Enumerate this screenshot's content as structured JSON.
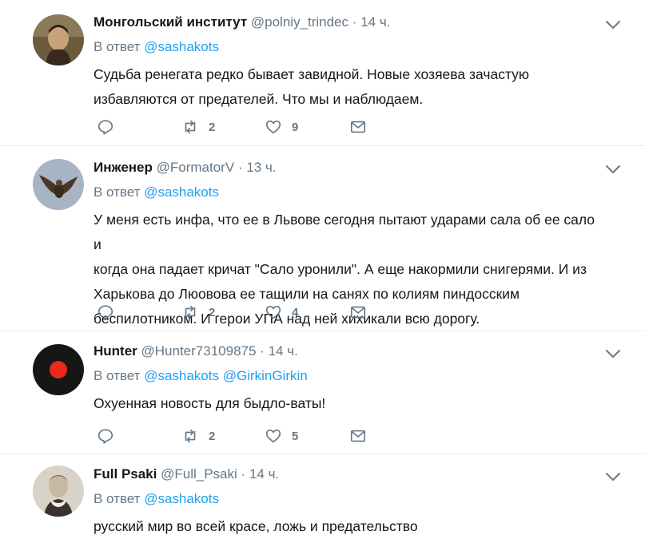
{
  "tweets": [
    {
      "name": "Монгольский институт",
      "handle": "@polniy_trindec",
      "dot": "·",
      "time": "14 ч.",
      "reply_prefix": "В ответ",
      "mentions": [
        "@sashakots"
      ],
      "text_lines": [
        "Судьба ренегата редко бывает завидной. Новые хозяева зачастую",
        "избавляются от предателей. Что мы и наблюдаем."
      ],
      "retweets": "2",
      "likes": "9"
    },
    {
      "name": "Инженер",
      "handle": "@FormatorV",
      "dot": "·",
      "time": "13 ч.",
      "reply_prefix": "В ответ",
      "mentions": [
        "@sashakots"
      ],
      "text_lines": [
        "У меня есть инфа, что ее в Львове сегодня пытают ударами сала об ее сало и",
        "когда она падает кричат \"Сало уронили\". А еще накормили снигерями. И из",
        "Харькова до Люовова ее тащили на санях по колиям пиндосским",
        "беспилотником. И герои УПА над ней хихикали всю дорогу."
      ],
      "retweets": "2",
      "likes": "4"
    },
    {
      "name": "Hunter",
      "handle": "@Hunter73109875",
      "dot": "·",
      "time": "14 ч.",
      "reply_prefix": "В ответ",
      "mentions": [
        "@sashakots",
        "@GirkinGirkin"
      ],
      "text_lines": [
        "Охуенная новость для быдло-ваты!"
      ],
      "retweets": "2",
      "likes": "5"
    },
    {
      "name": "Full Psaki",
      "handle": "@Full_Psaki",
      "dot": "·",
      "time": "14 ч.",
      "reply_prefix": "В ответ",
      "mentions": [
        "@sashakots"
      ],
      "text_lines": [
        "русский мир во всей красе, ложь и предательство"
      ]
    }
  ],
  "colors": {
    "name": "#14171a",
    "secondary": "#657786",
    "link": "#1da1f2",
    "border": "#e6ecf0"
  },
  "icons": [
    "reply-icon",
    "retweet-icon",
    "like-icon",
    "direct-message-icon",
    "chevron-down-icon"
  ]
}
